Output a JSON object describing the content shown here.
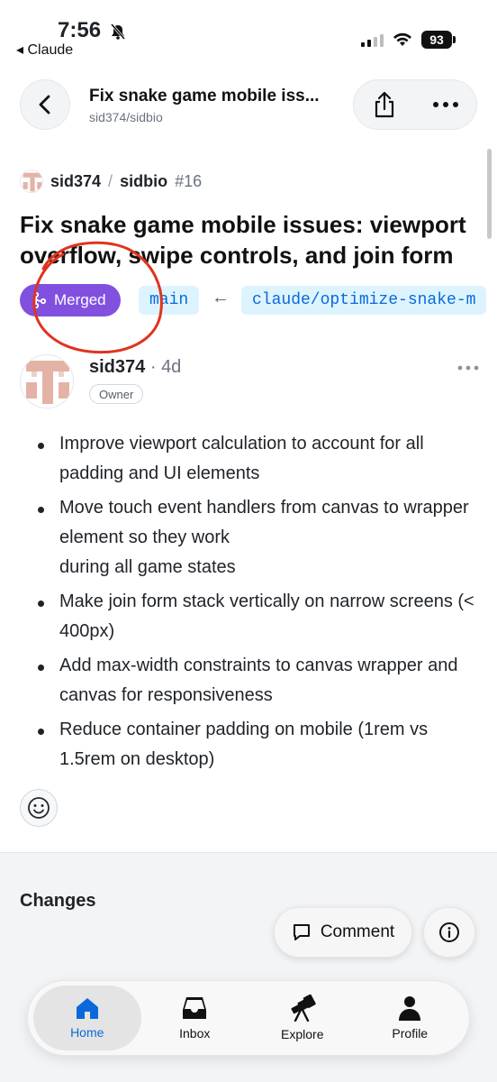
{
  "status_bar": {
    "time": "7:56",
    "back_app": "◂ Claude",
    "battery": "93",
    "signal_bars": [
      true,
      true,
      false,
      false
    ]
  },
  "header": {
    "title": "Fix snake game mobile iss...",
    "subtitle": "sid374/sidbio"
  },
  "repo": {
    "owner": "sid374",
    "separator": "/",
    "name": "sidbio",
    "number": "#16"
  },
  "pull_request": {
    "title": "Fix snake game mobile issues: viewport overflow, swipe controls, and join form",
    "status": "Merged",
    "status_color": "#8250df",
    "base_branch": "main",
    "arrow": "←",
    "head_branch": "claude/optimize-snake-m"
  },
  "annotation_color": "#e0331f",
  "comment": {
    "author": "sid374",
    "dot": "·",
    "age": "4d",
    "role": "Owner",
    "body_items": [
      "Improve viewport calculation to account for all padding and UI elements",
      "Move touch event handlers from canvas to wrapper element so they work\nduring all game states",
      "Make join form stack vertically on narrow screens (< 400px)",
      "Add max-width constraints to canvas wrapper and canvas for responsiveness",
      "Reduce container padding on mobile (1rem vs 1.5rem on desktop)"
    ]
  },
  "changes_heading": "Changes",
  "floating": {
    "comment_label": "Comment"
  },
  "tab_bar": {
    "active": "home",
    "tabs": [
      {
        "id": "home",
        "label": "Home",
        "icon": "home-icon"
      },
      {
        "id": "inbox",
        "label": "Inbox",
        "icon": "inbox-icon"
      },
      {
        "id": "explore",
        "label": "Explore",
        "icon": "telescope-icon"
      },
      {
        "id": "profile",
        "label": "Profile",
        "icon": "person-icon"
      }
    ]
  },
  "accent_color": "#0969da"
}
